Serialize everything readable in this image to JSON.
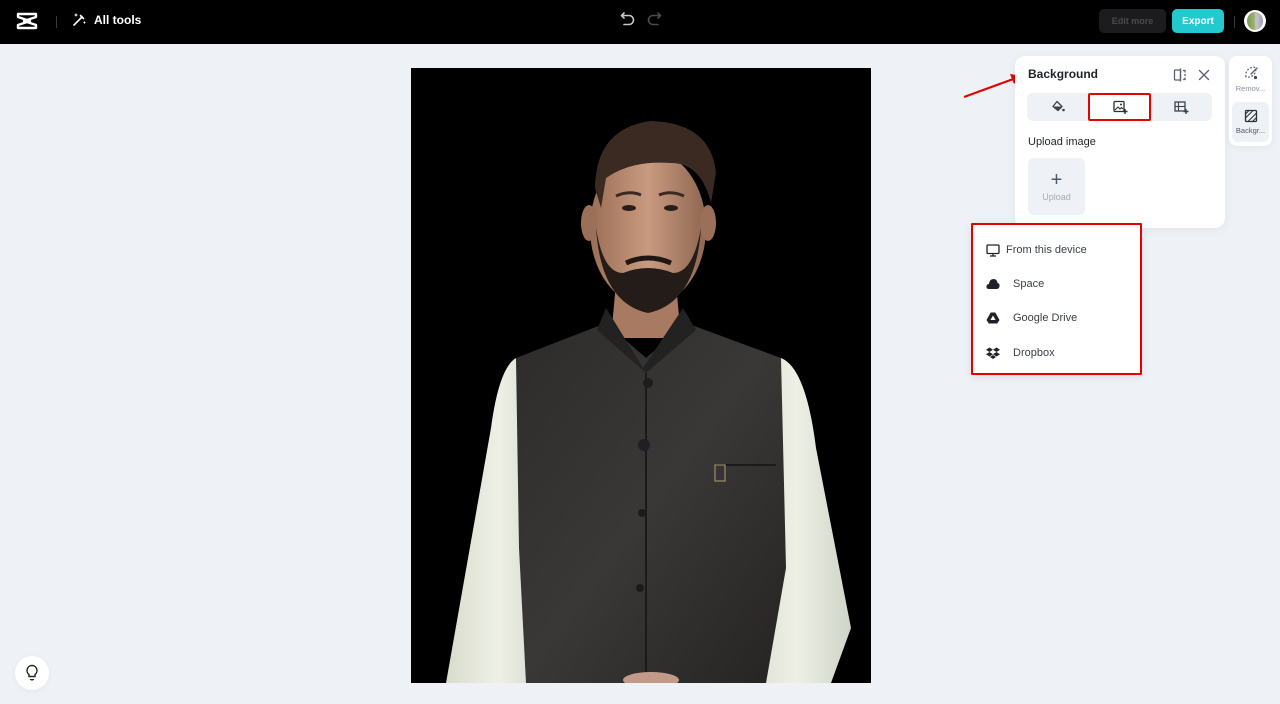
{
  "app": {
    "logo_icon": "capcut-logo-icon"
  },
  "topbar": {
    "all_tools_label": "All tools",
    "all_tools_icon": "magic-wand-icon",
    "undo_icon": "undo-icon",
    "redo_icon": "redo-icon",
    "edit_more_label": "Edit more",
    "export_label": "Export",
    "export_color": "#22c9cf",
    "avatar_icon": "user-avatar"
  },
  "canvas": {
    "image_alt": "Portrait of a man in a dark waistcoat over a white kurta on a black background",
    "background_color": "#000000"
  },
  "background_panel": {
    "title": "Background",
    "compare_icon": "compare-icon",
    "close_icon": "close-icon",
    "tabs": [
      {
        "name": "color",
        "icon": "paint-bucket-icon",
        "active": false
      },
      {
        "name": "image",
        "icon": "image-add-icon",
        "active": true
      },
      {
        "name": "template",
        "icon": "template-add-icon",
        "active": false
      }
    ],
    "upload_section_label": "Upload image",
    "upload_tile_label": "Upload",
    "upload_tile_icon": "plus-icon"
  },
  "right_rail": {
    "items": [
      {
        "label": "Remov...",
        "icon": "remove-background-icon",
        "active": false
      },
      {
        "label": "Backgr...",
        "icon": "background-icon",
        "active": true
      }
    ]
  },
  "upload_source_menu": {
    "items": [
      {
        "label": "From this device",
        "icon": "monitor-icon"
      },
      {
        "label": "Space",
        "icon": "cloud-icon"
      },
      {
        "label": "Google Drive",
        "icon": "google-drive-icon"
      },
      {
        "label": "Dropbox",
        "icon": "dropbox-icon"
      }
    ]
  },
  "annotations": {
    "highlight_color": "#e60000"
  },
  "tips_button_icon": "lightbulb-icon"
}
